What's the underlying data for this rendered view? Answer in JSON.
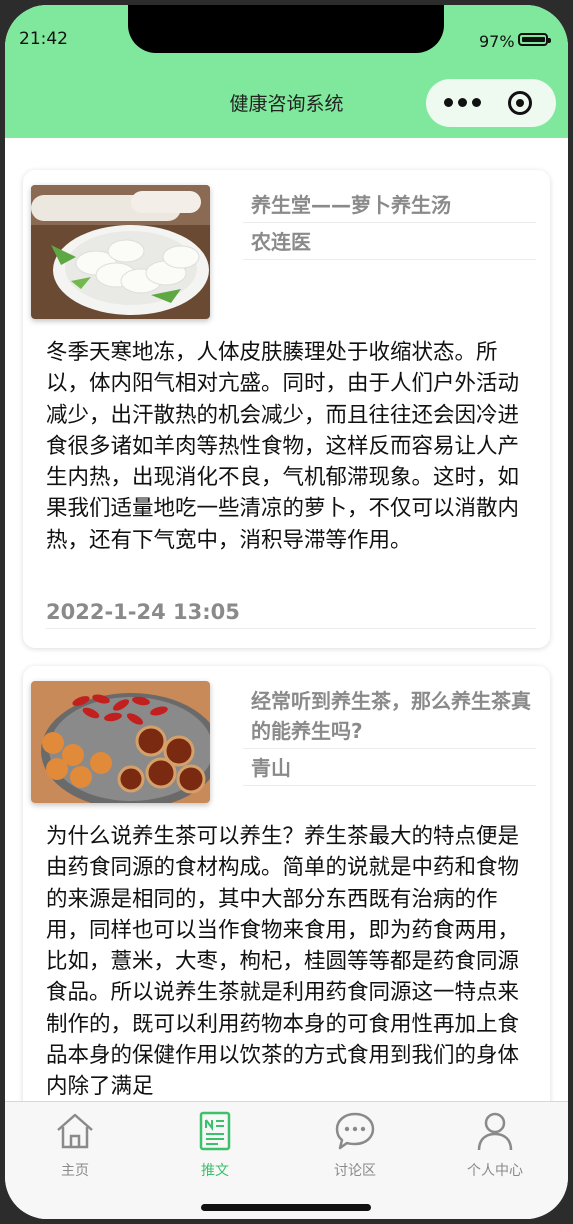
{
  "status_bar": {
    "time": "21:42",
    "battery": "97%"
  },
  "header": {
    "title": "健康咨询系统"
  },
  "colors": {
    "header_bg": "#80e89c",
    "active_tab": "#3cc06b",
    "muted_text": "#8a8a8a"
  },
  "posts": [
    {
      "image_icon": "sliced-radish-photo",
      "title": "养生堂——萝卜养生汤",
      "author": "农连医",
      "body": "冬季天寒地冻，人体皮肤腠理处于收缩状态。所以，体内阳气相对亢盛。同时，由于人们户外活动减少，出汗散热的机会减少，而且往往还会因冷进食很多诸如羊肉等热性食物，这样反而容易让人产生内热，出现消化不良，气机郁滞现象。这时，如果我们适量地吃一些清凉的萝卜，不仅可以消散内热，还有下气宽中，消积导滞等作用。",
      "date": "2022-1-24 13:05"
    },
    {
      "image_icon": "goji-jujube-longan-photo",
      "title": "经常听到养生茶，那么养生茶真的能养生吗?",
      "author": "青山",
      "body": "为什么说养生茶可以养生？养生茶最大的特点便是由药食同源的食材构成。简单的说就是中药和食物的来源是相同的，其中大部分东西既有治病的作用，同样也可以当作食物来食用，即为药食两用，比如，薏米，大枣，枸杞，桂圆等等都是药食同源食品。所以说养生茶就是利用药食同源这一特点来制作的，既可以利用药物本身的可食用性再加上食品本身的保健作用以饮茶的方式食用到我们的身体内除了满足"
    }
  ],
  "tabs": [
    {
      "label": "主页",
      "icon": "home-icon",
      "active": false
    },
    {
      "label": "推文",
      "icon": "article-icon",
      "active": true
    },
    {
      "label": "讨论区",
      "icon": "chat-icon",
      "active": false
    },
    {
      "label": "个人中心",
      "icon": "user-icon",
      "active": false
    }
  ]
}
